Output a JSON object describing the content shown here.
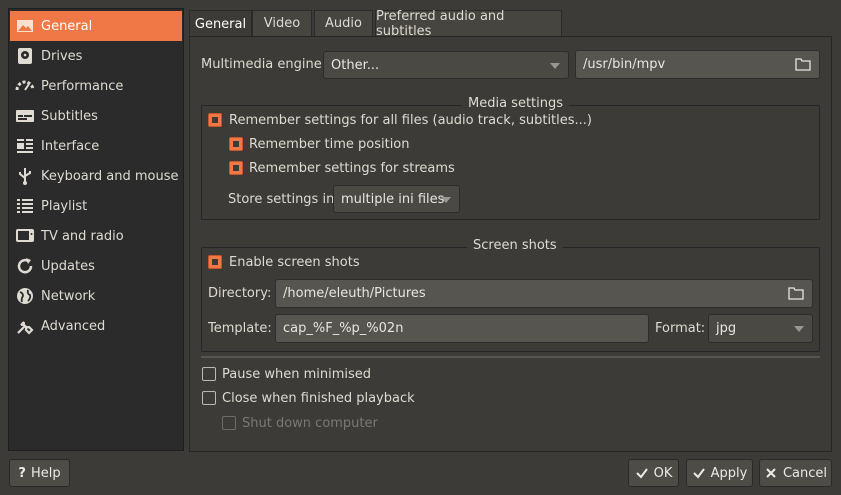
{
  "sidebar": {
    "items": [
      {
        "label": "General",
        "icon": "picture-icon"
      },
      {
        "label": "Drives",
        "icon": "drive-icon"
      },
      {
        "label": "Performance",
        "icon": "gauge-icon"
      },
      {
        "label": "Subtitles",
        "icon": "subtitles-icon"
      },
      {
        "label": "Interface",
        "icon": "interface-icon"
      },
      {
        "label": "Keyboard and mouse",
        "icon": "usb-icon"
      },
      {
        "label": "Playlist",
        "icon": "list-icon"
      },
      {
        "label": "TV and radio",
        "icon": "tv-icon"
      },
      {
        "label": "Updates",
        "icon": "refresh-icon"
      },
      {
        "label": "Network",
        "icon": "globe-icon"
      },
      {
        "label": "Advanced",
        "icon": "wrench-icon"
      }
    ],
    "active": "General"
  },
  "tabs": [
    "General",
    "Video",
    "Audio",
    "Preferred audio and subtitles"
  ],
  "engine": {
    "label": "Multimedia engine:",
    "value": "Other...",
    "path": "/usr/bin/mpv"
  },
  "media": {
    "title": "Media settings",
    "remember_all": "Remember settings for all files (audio track, subtitles...)",
    "remember_time": "Remember time position",
    "remember_streams": "Remember settings for streams",
    "store_label": "Store settings in",
    "store_value": "multiple ini files"
  },
  "screenshots": {
    "title": "Screen shots",
    "enable": "Enable screen shots",
    "dir_label": "Directory:",
    "dir_value": "/home/eleuth/Pictures",
    "template_label": "Template:",
    "template_value": "cap_%F_%p_%02n",
    "format_label": "Format:",
    "format_value": "jpg"
  },
  "options": {
    "pause": "Pause when minimised",
    "close": "Close when finished playback",
    "shutdown": "Shut down computer"
  },
  "buttons": {
    "help": "Help",
    "ok": "OK",
    "apply": "Apply",
    "cancel": "Cancel"
  },
  "colors": {
    "accent": "#f07746",
    "background": "#3c3b37",
    "sidebar": "#2b2b2b"
  }
}
